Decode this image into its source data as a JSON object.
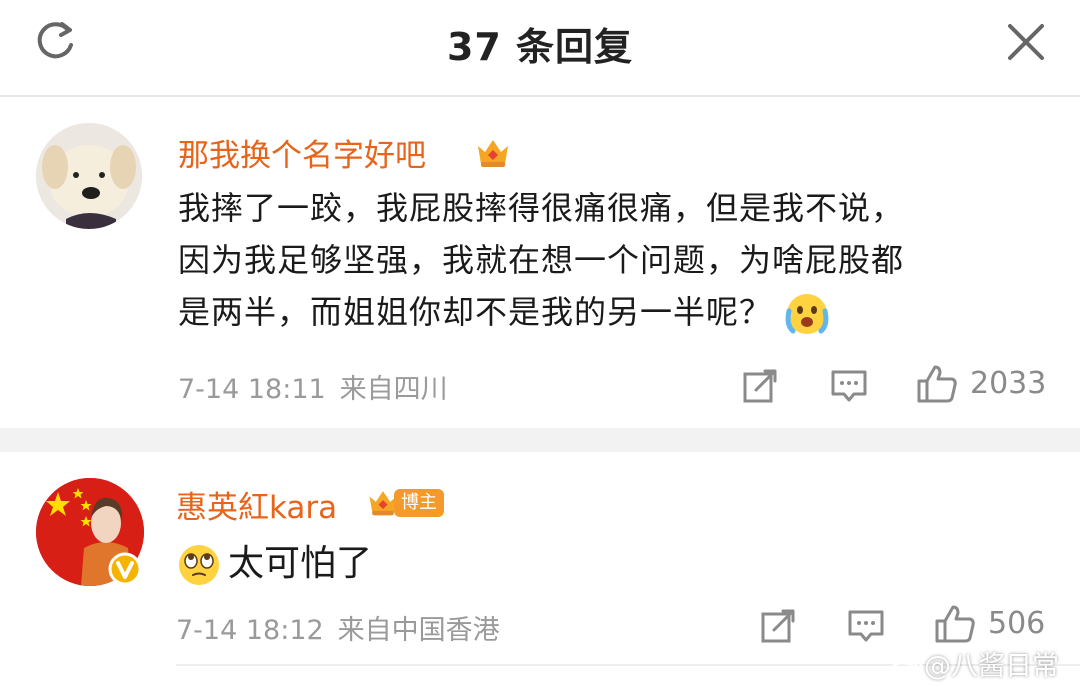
{
  "header": {
    "title": "37 条回复",
    "refresh_icon": "refresh-icon",
    "close_icon": "close-icon"
  },
  "comments": [
    {
      "username": "那我换个名字好吧",
      "badge_icon": "crown-badge-icon",
      "content_lines": [
        "我摔了一跤，我屁股摔得很痛很痛，但是我不说，",
        "因为我足够坚强，我就在想一个问题，为啥屁股都",
        "是两半，而姐姐你却不是我的另一半呢？"
      ],
      "content_emoji": "crying-laughing-emoji",
      "time": "7-14 18:11",
      "location": "来自四川",
      "likes": "2033"
    },
    {
      "username": "惠英紅kara",
      "badge_icon": "crown-badge-icon",
      "badge_label": "博主",
      "verified_icon": "verified-v-icon",
      "content_emoji": "eye-roll-emoji",
      "content": "太可怕了",
      "time": "7-14 18:12",
      "location": "来自中国香港",
      "likes": "506"
    }
  ],
  "watermark": {
    "text": "@八酱日常",
    "icon": "weibo-icon"
  },
  "colors": {
    "username": "#e8641b",
    "meta": "#9a9a9a",
    "badge": "#f39a2b",
    "section_gap": "#f2f2f2"
  }
}
